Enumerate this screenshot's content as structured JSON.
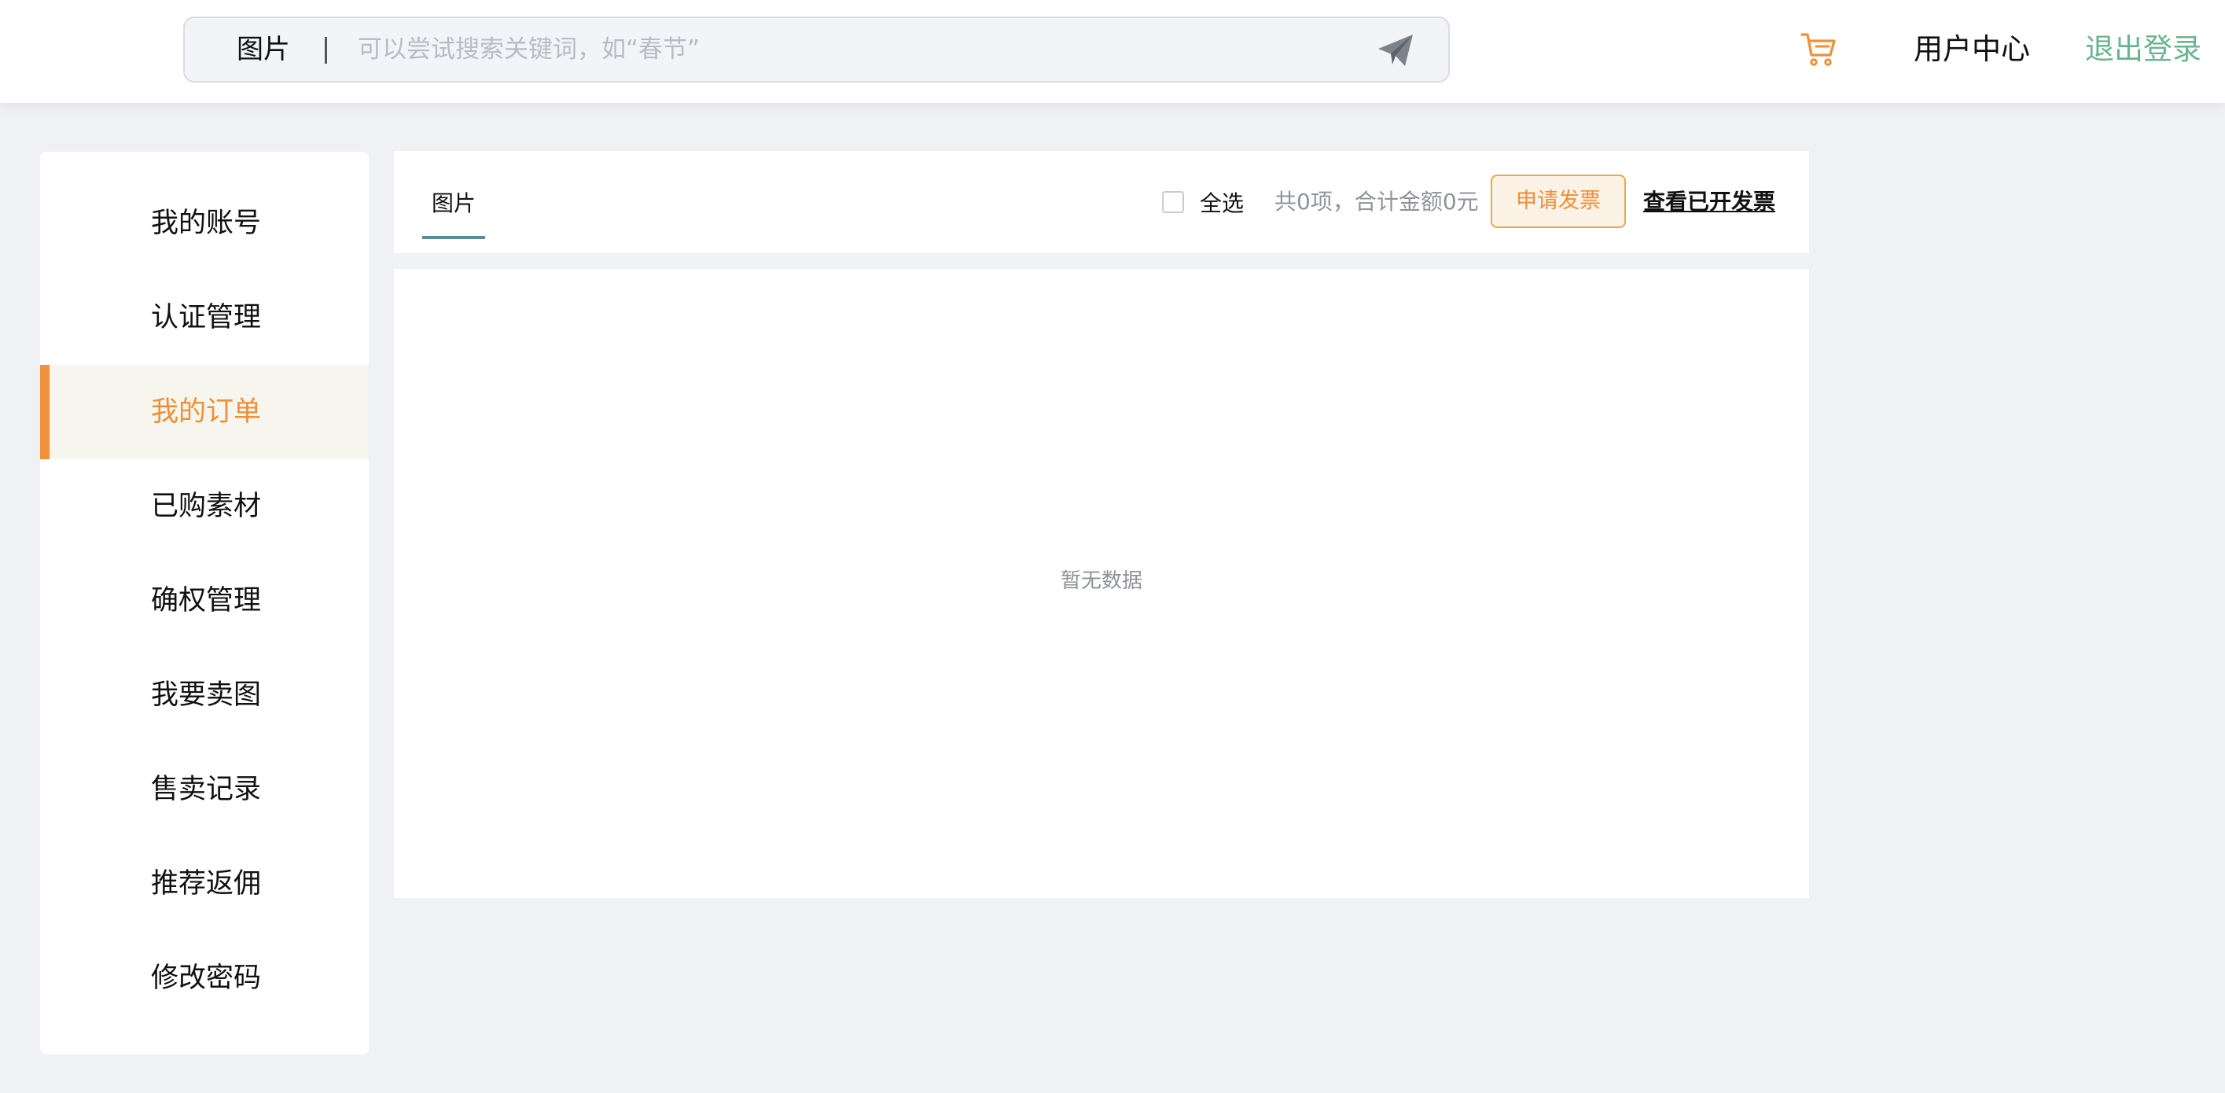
{
  "header": {
    "search": {
      "category": "图片",
      "placeholder": "可以尝试搜索关键词，如“春节”",
      "value": ""
    },
    "user_center": "用户中心",
    "logout": "退出登录",
    "icons": {
      "send": "paper-plane-icon",
      "cart": "shopping-cart-icon"
    }
  },
  "sidebar": {
    "items": [
      {
        "label": "我的账号",
        "active": false
      },
      {
        "label": "认证管理",
        "active": false
      },
      {
        "label": "我的订单",
        "active": true
      },
      {
        "label": "已购素材",
        "active": false
      },
      {
        "label": "确权管理",
        "active": false
      },
      {
        "label": "我要卖图",
        "active": false
      },
      {
        "label": "售卖记录",
        "active": false
      },
      {
        "label": "推荐返佣",
        "active": false
      },
      {
        "label": "修改密码",
        "active": false
      }
    ]
  },
  "orders": {
    "tabs": [
      {
        "label": "图片",
        "active": true
      }
    ],
    "select_all_label": "全选",
    "select_all_checked": false,
    "summary": "共0项，合计金额0元",
    "invoice_button": "申请发票",
    "view_invoices": "查看已开发票",
    "empty_text": "暂无数据"
  },
  "colors": {
    "accent": "#ef8f36",
    "logout": "#6ab38f",
    "tab_underline": "#5b8b96",
    "active_bg": "#f7f6ee",
    "page_bg": "#f0f1f5"
  }
}
